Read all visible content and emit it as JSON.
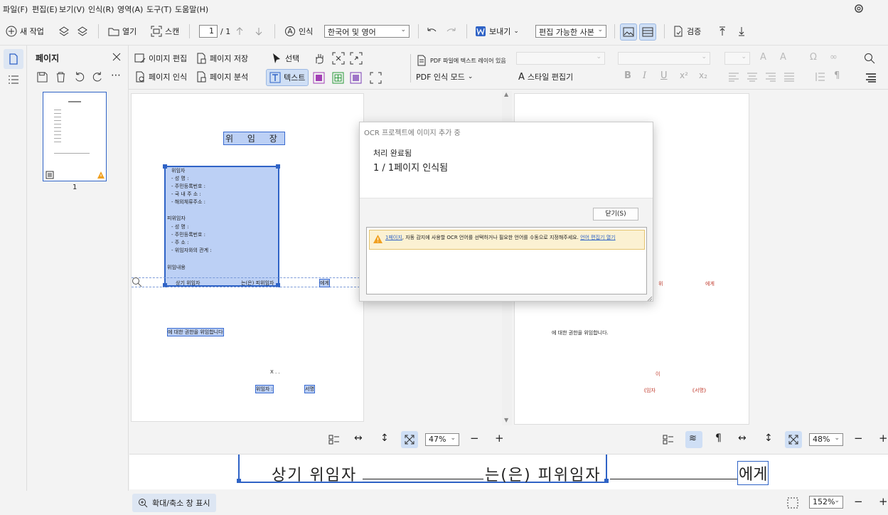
{
  "menu": [
    "파일(F)",
    "편집(E)",
    "보기(V)",
    "인식(R)",
    "영역(A)",
    "도구(T)",
    "도움말(H)"
  ],
  "toolbar": {
    "new_task": "새 작업",
    "open": "열기",
    "scan": "스캔",
    "page_current": "1",
    "page_total": "/ 1",
    "recognize": "인식",
    "language": "한국어 및 영어",
    "send": "보내기",
    "export_format": "편집 가능한 사본",
    "verify": "검증"
  },
  "pages_panel": {
    "title": "페이지",
    "thumb_page_number": "1"
  },
  "toolbar2": {
    "edit_image": "이미지 편집",
    "save_page": "페이지 저장",
    "recognize_page": "페이지 인식",
    "analyze_page": "페이지 분석",
    "select": "선택",
    "text": "텍스트",
    "pdf_text_layer": "PDF 파일에 텍스트 레이어 있음",
    "pdf_mode": "PDF 인식 모드",
    "style_editor": "스타일 편집기"
  },
  "doc_left": {
    "title": "위 임 장",
    "delegator": "위임자",
    "lines1": [
      "- 성 명 :",
      "- 주민등록번호 :",
      "- 국 내 주 소 :",
      "- 해외체류주소 :"
    ],
    "delegate": "피위임자",
    "lines2": [
      "- 성 명 :",
      "- 주민등록번호 :",
      "- 주 소 :",
      "- 위임자와의 관계 :"
    ],
    "content": "위임내용",
    "line_main": "상기 위임자",
    "line_main2": "는(은) 피위임자",
    "line_main3": "에게",
    "authority": "에 대한 권한을 위임합니다",
    "date_mark": "X . .",
    "signer": "위임자 :",
    "sign": "서명"
  },
  "doc_right": {
    "authority": "에 대한 권한을 위임합니다.",
    "frag1": "위",
    "frag2": "에게",
    "frag3": "《임자",
    "frag4": "《서명》",
    "frag5": "이"
  },
  "zoom_left": {
    "value": "47%"
  },
  "zoom_right": {
    "value": "48%"
  },
  "zoom_strip": {
    "part1": "상기 위임자",
    "part2": "는(은) 피위임자",
    "part3": "에게"
  },
  "status": {
    "zoom_window": "확대/축소 창 표시",
    "zoom": "152%"
  },
  "dialog": {
    "title": "OCR 프로젝트에 이미지 추가 중",
    "status": "처리 완료됨",
    "progress": "1 / 1페이지 인식됨",
    "close": "닫기(S)",
    "warning_link": "1페이지",
    "warning_text": ", 자동 감지에 사용할 OCR 언어를 선택하거나 필요한 언어를 수동으로 지정해주세요.",
    "warning_action": "언어 편집기 열기"
  },
  "colors": {
    "accent": "#2f63c6",
    "warning": "#f0a020",
    "highlight": "#bcd0f5"
  }
}
